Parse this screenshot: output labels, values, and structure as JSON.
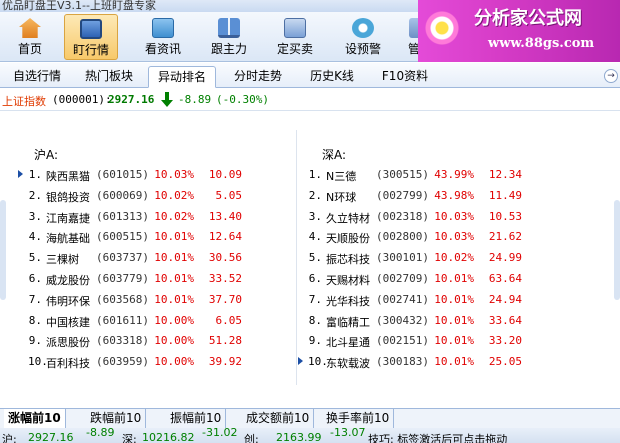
{
  "window": {
    "title": "优品盯盘王V3.1--上班盯盘专家"
  },
  "toolbar": {
    "items": [
      {
        "label": "首页",
        "icon": "home-icon",
        "color": "#e8973a"
      },
      {
        "label": "盯行情",
        "icon": "monitor-icon",
        "color": "#4a7dc7"
      },
      {
        "label": "看资讯",
        "icon": "news-icon",
        "color": "#3f8fd0"
      },
      {
        "label": "跟主力",
        "icon": "screens-icon",
        "color": "#5a8fd4"
      },
      {
        "label": "定买卖",
        "icon": "trade-icon",
        "color": "#7aa0d6"
      },
      {
        "label": "设预警",
        "icon": "alarm-icon",
        "color": "#4aa6d8"
      },
      {
        "label": "管股",
        "icon": "manage-icon",
        "color": "#6c8fc5"
      }
    ],
    "active_index": 1
  },
  "banner": {
    "title": "分析家公式网",
    "url": "www.88gs.com"
  },
  "tabs": {
    "items": [
      "自选行情",
      "热门板块",
      "异动排名",
      "分时走势",
      "历史K线",
      "F10资料"
    ],
    "active_index": 2
  },
  "index_bar": {
    "name": "上证指数",
    "code": "(000001):",
    "price": "2927.16",
    "change": "-8.89",
    "change_pct": "(-0.30%)"
  },
  "tables": {
    "sh": {
      "title": "沪A:",
      "rows": [
        {
          "n": "1.",
          "name": "陕西黑猫",
          "code": "(601015)",
          "pct": "10.03%",
          "price": "10.09"
        },
        {
          "n": "2.",
          "name": "银鸽投资",
          "code": "(600069)",
          "pct": "10.02%",
          "price": "5.05"
        },
        {
          "n": "3.",
          "name": "江南嘉捷",
          "code": "(601313)",
          "pct": "10.02%",
          "price": "13.40"
        },
        {
          "n": "4.",
          "name": "海航基础",
          "code": "(600515)",
          "pct": "10.01%",
          "price": "12.64"
        },
        {
          "n": "5.",
          "name": "三棵树",
          "code": "(603737)",
          "pct": "10.01%",
          "price": "30.56"
        },
        {
          "n": "6.",
          "name": "威龙股份",
          "code": "(603779)",
          "pct": "10.01%",
          "price": "33.52"
        },
        {
          "n": "7.",
          "name": "伟明环保",
          "code": "(603568)",
          "pct": "10.01%",
          "price": "37.70"
        },
        {
          "n": "8.",
          "name": "中国核建",
          "code": "(601611)",
          "pct": "10.00%",
          "price": "6.05"
        },
        {
          "n": "9.",
          "name": "派思股份",
          "code": "(603318)",
          "pct": "10.00%",
          "price": "51.28"
        },
        {
          "n": "10.",
          "name": "百利科技",
          "code": "(603959)",
          "pct": "10.00%",
          "price": "39.92"
        }
      ]
    },
    "sz": {
      "title": "深A:",
      "rows": [
        {
          "n": "1.",
          "name": "N三德",
          "code": "(300515)",
          "pct": "43.99%",
          "price": "12.34"
        },
        {
          "n": "2.",
          "name": "N环球",
          "code": "(002799)",
          "pct": "43.98%",
          "price": "11.49"
        },
        {
          "n": "3.",
          "name": "久立特材",
          "code": "(002318)",
          "pct": "10.03%",
          "price": "10.53"
        },
        {
          "n": "4.",
          "name": "天顺股份",
          "code": "(002800)",
          "pct": "10.03%",
          "price": "21.62"
        },
        {
          "n": "5.",
          "name": "振芯科技",
          "code": "(300101)",
          "pct": "10.02%",
          "price": "24.99"
        },
        {
          "n": "6.",
          "name": "天赐材料",
          "code": "(002709)",
          "pct": "10.01%",
          "price": "63.64"
        },
        {
          "n": "7.",
          "name": "光华科技",
          "code": "(002741)",
          "pct": "10.01%",
          "price": "24.94"
        },
        {
          "n": "8.",
          "name": "富临精工",
          "code": "(300432)",
          "pct": "10.01%",
          "price": "33.64"
        },
        {
          "n": "9.",
          "name": "北斗星通",
          "code": "(002151)",
          "pct": "10.01%",
          "price": "33.20"
        },
        {
          "n": "10.",
          "name": "东软载波",
          "code": "(300183)",
          "pct": "10.01%",
          "price": "25.05"
        }
      ]
    }
  },
  "bottom_tabs": {
    "items": [
      "涨幅前10",
      "跌幅前10",
      "振幅前10",
      "成交额前10",
      "换手率前10"
    ],
    "active_index": 0
  },
  "status": {
    "sh_label": "沪:",
    "sh_value": "2927.16",
    "sh_change": "-8.89",
    "sz_label": "深:",
    "sz_value": "10216.82",
    "sz_change": "-31.02",
    "cy_label": "创:",
    "cy_value": "2163.99",
    "cy_change": "-13.07",
    "tip": "技巧: 标签激活后可点击拖动"
  },
  "colors": {
    "up": "#e00000",
    "down": "#008000",
    "index_name": "#e03a00",
    "accent": "#1c4fa5"
  }
}
